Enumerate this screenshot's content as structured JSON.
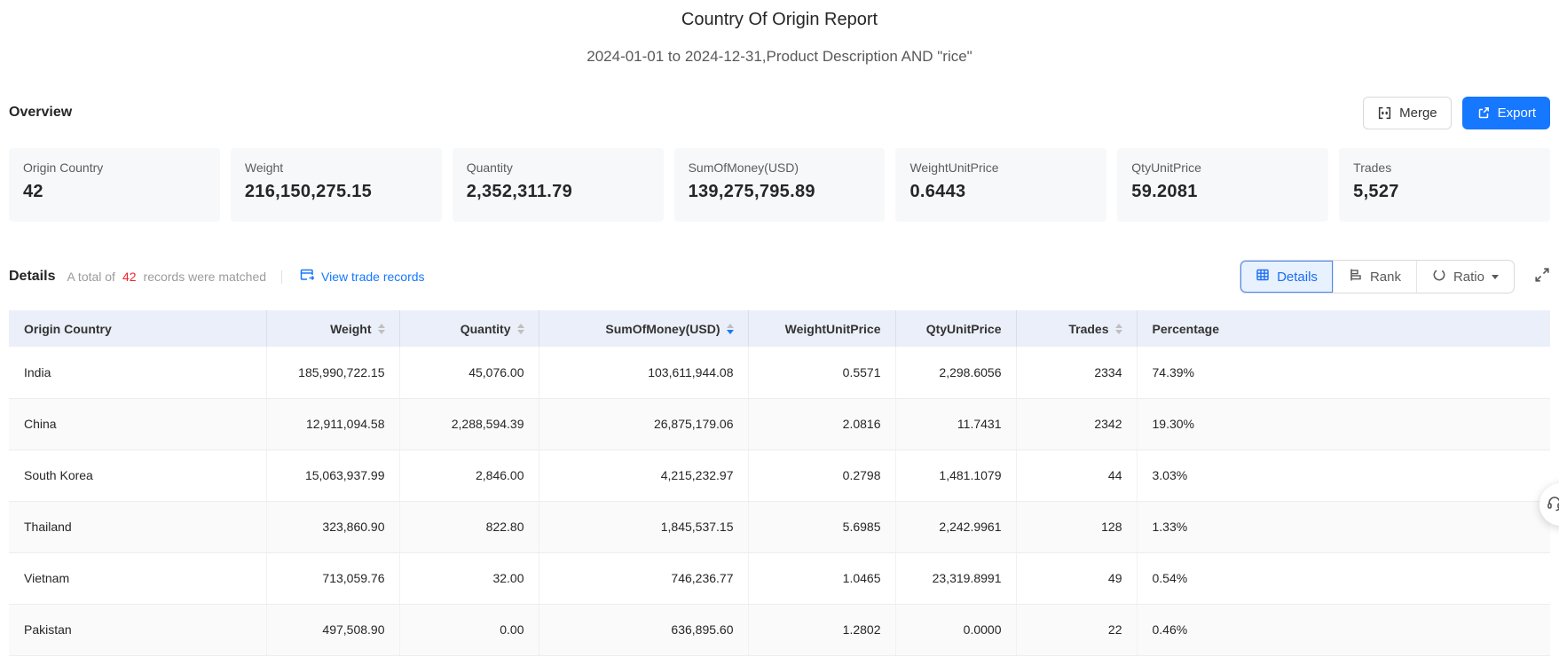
{
  "header": {
    "title": "Country Of Origin Report",
    "subtitle": "2024-01-01 to 2024-12-31,Product Description AND \"rice\""
  },
  "overview": {
    "section_title": "Overview",
    "merge_label": "Merge",
    "export_label": "Export",
    "cards": [
      {
        "label": "Origin Country",
        "value": "42"
      },
      {
        "label": "Weight",
        "value": "216,150,275.15"
      },
      {
        "label": "Quantity",
        "value": "2,352,311.79"
      },
      {
        "label": "SumOfMoney(USD)",
        "value": "139,275,795.89"
      },
      {
        "label": "WeightUnitPrice",
        "value": "0.6443"
      },
      {
        "label": "QtyUnitPrice",
        "value": "59.2081"
      },
      {
        "label": "Trades",
        "value": "5,527"
      }
    ]
  },
  "details": {
    "section_title": "Details",
    "matched_prefix": "A total of",
    "matched_count": "42",
    "matched_suffix": "records were matched",
    "view_trade_records_label": "View trade records",
    "tabs": [
      {
        "label": "Details"
      },
      {
        "label": "Rank"
      },
      {
        "label": "Ratio"
      }
    ],
    "active_tab": "Details"
  },
  "table": {
    "columns": [
      "Origin Country",
      "Weight",
      "Quantity",
      "SumOfMoney(USD)",
      "WeightUnitPrice",
      "QtyUnitPrice",
      "Trades",
      "Percentage"
    ],
    "sorted_column": "SumOfMoney(USD)",
    "sort_direction": "desc",
    "rows": [
      {
        "country": "India",
        "weight": "185,990,722.15",
        "quantity": "45,076.00",
        "sum": "103,611,944.08",
        "wup": "0.5571",
        "qup": "2,298.6056",
        "trades": "2334",
        "pct": "74.39%"
      },
      {
        "country": "China",
        "weight": "12,911,094.58",
        "quantity": "2,288,594.39",
        "sum": "26,875,179.06",
        "wup": "2.0816",
        "qup": "11.7431",
        "trades": "2342",
        "pct": "19.30%"
      },
      {
        "country": "South Korea",
        "weight": "15,063,937.99",
        "quantity": "2,846.00",
        "sum": "4,215,232.97",
        "wup": "0.2798",
        "qup": "1,481.1079",
        "trades": "44",
        "pct": "3.03%"
      },
      {
        "country": "Thailand",
        "weight": "323,860.90",
        "quantity": "822.80",
        "sum": "1,845,537.15",
        "wup": "5.6985",
        "qup": "2,242.9961",
        "trades": "128",
        "pct": "1.33%"
      },
      {
        "country": "Vietnam",
        "weight": "713,059.76",
        "quantity": "32.00",
        "sum": "746,236.77",
        "wup": "1.0465",
        "qup": "23,319.8991",
        "trades": "49",
        "pct": "0.54%"
      },
      {
        "country": "Pakistan",
        "weight": "497,508.90",
        "quantity": "0.00",
        "sum": "636,895.60",
        "wup": "1.2802",
        "qup": "0.0000",
        "trades": "22",
        "pct": "0.46%"
      }
    ]
  },
  "colors": {
    "accent": "#1677ff",
    "count_red": "#f5222d"
  }
}
